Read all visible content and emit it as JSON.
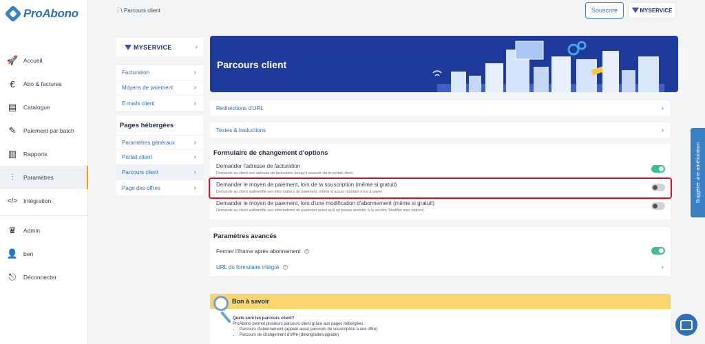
{
  "brand": {
    "name": "ProAbono"
  },
  "sidebar": {
    "items": [
      {
        "label": "Accueil",
        "icon": "rocket-icon",
        "glyph": "🚀"
      },
      {
        "label": "Abo & factures",
        "icon": "euro-icon",
        "glyph": "€"
      },
      {
        "label": "Catalogue",
        "icon": "catalog-icon",
        "glyph": "▤"
      },
      {
        "label": "Paiement par batch",
        "icon": "batch-payment-icon",
        "glyph": "✎"
      },
      {
        "label": "Rapports",
        "icon": "reports-icon",
        "glyph": "▥"
      },
      {
        "label": "Paramètres",
        "icon": "settings-sliders-icon",
        "glyph": "⫶"
      },
      {
        "label": "Intégration",
        "icon": "code-icon",
        "glyph": "</>"
      }
    ],
    "account": [
      {
        "label": "Admin",
        "icon": "crown-icon",
        "glyph": "♛"
      },
      {
        "label": "ben",
        "icon": "user-icon",
        "glyph": "👤"
      },
      {
        "label": "Déconnecter",
        "icon": "logout-icon",
        "glyph": "⎋"
      }
    ]
  },
  "header": {
    "breadcrumb": "\\ Parcours client",
    "souscrire_label": "Souscrire",
    "brand_badge": "MYSERVICE"
  },
  "subpanel": {
    "brand_label": "MYSERVICE",
    "links": [
      {
        "label": "Facturation"
      },
      {
        "label": "Moyens de paiement"
      },
      {
        "label": "E-mails client"
      }
    ],
    "pages_heading": "Pages hébergées",
    "pages": [
      {
        "label": "Paramètres généraux"
      },
      {
        "label": "Portail client"
      },
      {
        "label": "Parcours client"
      },
      {
        "label": "Page des offres"
      }
    ]
  },
  "hero": {
    "title": "Parcours client"
  },
  "links": {
    "redirections": "Redirections d'URL",
    "textes": "Textes & traductions"
  },
  "options_form": {
    "title": "Formulaire de changement d'options",
    "rows": [
      {
        "title": "Demander l'adresse de facturation",
        "desc": "Demande au client son adresse de facturation lorsqu'il souscrit via le portail client.",
        "enabled": true
      },
      {
        "title": "Demander le moyen de paiement, lors de la souscription (même si gratuit)",
        "desc": "Demande au client authentifié ses informations de paiement, même si aucun montant n'est à payer.",
        "enabled": false
      },
      {
        "title": "Demander le moyen de paiement, lors d'une modification d'abonnement (même si gratuit)",
        "desc": "Demande au client authentifié ses informations de paiement avant qu'il ne puisse accéder à la section 'Modifier mes options'.",
        "enabled": false
      }
    ]
  },
  "advanced": {
    "title": "Paramètres avancés",
    "iframe_label": "Fermer l'iframe après abonnement",
    "iframe_enabled": true,
    "url_label": "URL du formulaire intégré"
  },
  "tips": {
    "title": "Bon à savoir",
    "question": "Quels sont les parcours client?",
    "intro": "ProAbono permet plusieurs parcours client grâce aux pages hébergées :",
    "bullets": [
      "Parcours d'abonnement (appelé aussi parcours de souscription à une offre)",
      "Parcours de changement d'offre (downgrade/upgrade)"
    ]
  },
  "feedback": {
    "label": "Suggérer une amélioration"
  },
  "colors": {
    "accent": "#3b82c4",
    "hero": "#1e3a9a",
    "toggle_on": "#3cc08f",
    "highlight": "#c8171e",
    "tips": "#fbd56b"
  }
}
